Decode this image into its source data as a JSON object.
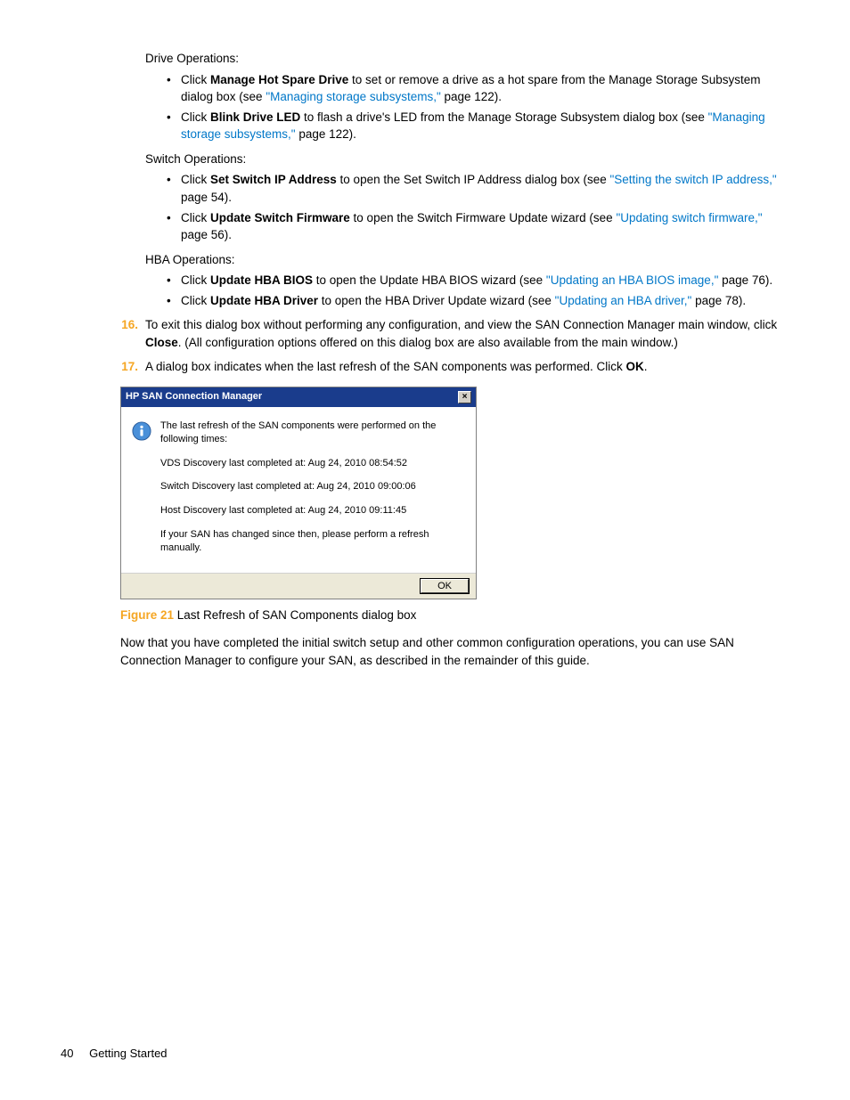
{
  "sections": {
    "drive": {
      "label": "Drive Operations:",
      "b1_pre": "Click ",
      "b1_bold": "Manage Hot Spare Drive",
      "b1_mid": " to set or remove a drive as a hot spare from the Manage Storage Subsystem dialog box (see ",
      "b1_link": "\"Managing storage subsystems,\"",
      "b1_post": " page 122).",
      "b2_pre": "Click ",
      "b2_bold": "Blink Drive LED",
      "b2_mid": " to flash a drive's LED from the Manage Storage Subsystem dialog box (see ",
      "b2_link": "\"Managing storage subsystems,\"",
      "b2_post": " page 122)."
    },
    "switch": {
      "label": "Switch Operations:",
      "b1_pre": "Click ",
      "b1_bold": "Set Switch IP Address",
      "b1_mid": " to open the Set Switch IP Address dialog box (see ",
      "b1_link": "\"Setting the switch IP address,\"",
      "b1_post": " page 54).",
      "b2_pre": "Click ",
      "b2_bold": "Update Switch Firmware",
      "b2_mid": " to open the Switch Firmware Update wizard (see ",
      "b2_link": "\"Updating switch firmware,\"",
      "b2_post": " page 56)."
    },
    "hba": {
      "label": "HBA Operations:",
      "b1_pre": "Click ",
      "b1_bold": "Update HBA BIOS",
      "b1_mid": " to open the Update HBA BIOS wizard (see ",
      "b1_link": "\"Updating an HBA BIOS image,\"",
      "b1_post": " page 76).",
      "b2_pre": "Click ",
      "b2_bold": "Update HBA Driver",
      "b2_mid": " to open the HBA Driver Update wizard (see ",
      "b2_link": "\"Updating an HBA driver,\"",
      "b2_post": " page 78)."
    }
  },
  "steps": {
    "s16_num": "16.",
    "s16_pre": "To exit this dialog box without performing any configuration, and view the SAN Connection Manager main window, click ",
    "s16_bold": "Close",
    "s16_post": ". (All configuration options offered on this dialog box are also available from the main window.)",
    "s17_num": "17.",
    "s17_pre": "A dialog box indicates when the last refresh of the SAN components was performed. Click ",
    "s17_bold": "OK",
    "s17_post": "."
  },
  "dialog": {
    "title": "HP SAN Connection Manager",
    "close": "×",
    "msg_intro": "The last refresh of the SAN components were performed on the following times:",
    "msg_vds": "VDS Discovery last completed at: Aug 24, 2010 08:54:52",
    "msg_switch": "Switch Discovery last completed at: Aug 24, 2010 09:00:06",
    "msg_host": "Host Discovery last completed at: Aug 24, 2010 09:11:45",
    "msg_refresh": "If your SAN has changed since then, please perform a refresh manually.",
    "ok": "OK"
  },
  "figure": {
    "label": "Figure 21",
    "caption": " Last Refresh of SAN Components dialog box"
  },
  "closing": "Now that you have completed the initial switch setup and other common configuration operations, you can use SAN Connection Manager to configure your SAN, as described in the remainder of this guide.",
  "footer": {
    "page": "40",
    "section": "Getting Started"
  }
}
